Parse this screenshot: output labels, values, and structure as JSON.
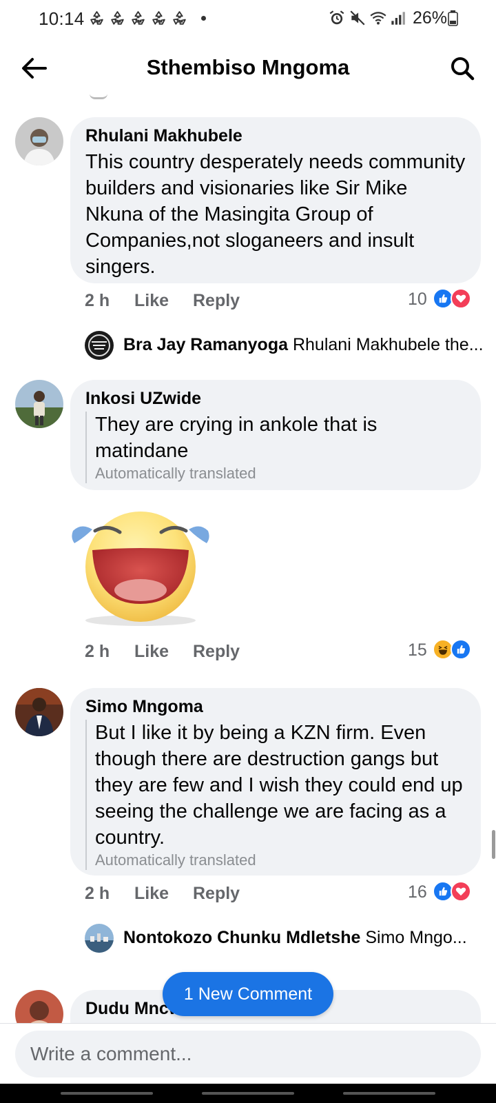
{
  "status_bar": {
    "time": "10:14",
    "battery": "26%",
    "icons": [
      "recycle-icon",
      "recycle-icon",
      "recycle-icon",
      "recycle-icon",
      "recycle-icon",
      "alarm-icon",
      "mute-icon",
      "wifi-icon",
      "signal-icon",
      "battery-icon"
    ]
  },
  "header": {
    "title": "Sthembiso Mngoma",
    "back_icon": "arrow-left-icon",
    "search_icon": "search-icon"
  },
  "colors": {
    "accent": "#1b74e4",
    "bubble": "#f0f2f5",
    "meta_text": "#65676b",
    "like": "#1877f2",
    "love": "#f33e58",
    "haha": "#f7b125"
  },
  "comments": [
    {
      "author": "Rhulani Makhubele",
      "text": "This country desperately needs community builders and visionaries like Sir Mike Nkuna of the Masingita Group of Companies,not sloganeers and insult singers.",
      "time": "2 h",
      "like_label": "Like",
      "reply_label": "Reply",
      "reaction_count": "10",
      "reactions": [
        "like-icon",
        "love-icon"
      ],
      "reply": {
        "author": "Bra Jay Ramanyoga",
        "preview": "Rhulani Makhubele the..."
      }
    },
    {
      "author": "Inkosi UZwide",
      "text": "They are crying in ankole that is matindane",
      "auto_translated": "Automatically translated",
      "sticker": "laughing-tears-sticker",
      "time": "2 h",
      "like_label": "Like",
      "reply_label": "Reply",
      "reaction_count": "15",
      "reactions": [
        "haha-icon",
        "like-icon"
      ]
    },
    {
      "author": "Simo Mngoma",
      "text": "But I like it by being a KZN firm. Even though there are destruction gangs but they are few and I wish they could end up seeing the challenge we are facing as a country.",
      "auto_translated": "Automatically translated",
      "time": "2 h",
      "like_label": "Like",
      "reply_label": "Reply",
      "reaction_count": "16",
      "reactions": [
        "like-icon",
        "love-icon"
      ],
      "reply": {
        "author": "Nontokozo Chunku Mdletshe",
        "preview": "Simo Mngo..."
      }
    },
    {
      "author": "Dudu Mncw"
    }
  ],
  "new_comment_pill": "1 New Comment",
  "composer": {
    "placeholder": "Write a comment..."
  }
}
